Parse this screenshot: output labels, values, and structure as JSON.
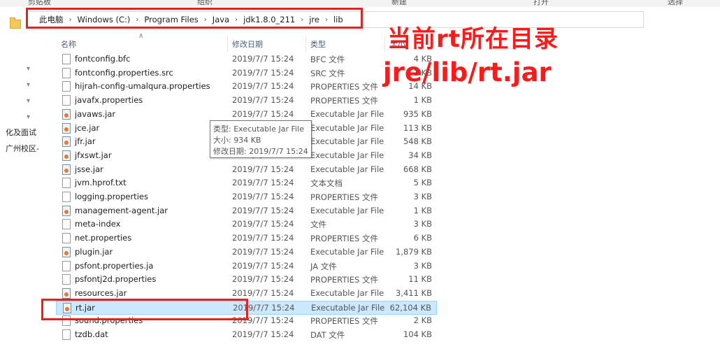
{
  "top_strip": [
    "剪贴板",
    "组织",
    "新建",
    "打开",
    "选择"
  ],
  "address_bar": {
    "crumbs": [
      "此电脑",
      "Windows (C:)",
      "Program Files",
      "Java",
      "jdk1.8.0_211",
      "jre",
      "lib"
    ]
  },
  "annotations": {
    "line1": "当前rt所在目录",
    "line2": "jre/lib/rt.jar"
  },
  "nav_pane": {
    "text1": "化及面试",
    "text2": "广州校区-"
  },
  "columns": {
    "name": "名称",
    "date": "修改日期",
    "type": "类型",
    "size": "大小"
  },
  "files": [
    {
      "name": "fontconfig.bfc",
      "date": "2019/7/7 15:24",
      "type": "BFC 文件",
      "size": "4 KB",
      "icon": "file-icon"
    },
    {
      "name": "fontconfig.properties.src",
      "date": "2019/7/7 15:24",
      "type": "SRC 文件",
      "size": "1 KB",
      "icon": "file-icon"
    },
    {
      "name": "hijrah-config-umalqura.properties",
      "date": "2019/7/7 15:24",
      "type": "PROPERTIES 文件",
      "size": "14 KB",
      "icon": "file-icon"
    },
    {
      "name": "javafx.properties",
      "date": "2019/7/7 15:24",
      "type": "PROPERTIES 文件",
      "size": "1 KB",
      "icon": "file-icon"
    },
    {
      "name": "javaws.jar",
      "date": "2019/7/7 15:24",
      "type": "Executable Jar File",
      "size": "935 KB",
      "icon": "jar-icon"
    },
    {
      "name": "jce.jar",
      "date": "2019/7/7 15:24",
      "type": "Executable Jar File",
      "size": "113 KB",
      "icon": "jar-icon"
    },
    {
      "name": "jfr.jar",
      "date": "2019/7/7 15:24",
      "type": "Executable Jar File",
      "size": "548 KB",
      "icon": "jar-icon"
    },
    {
      "name": "jfxswt.jar",
      "date": "2019/7/7 15:24",
      "type": "Executable Jar File",
      "size": "34 KB",
      "icon": "jar-icon"
    },
    {
      "name": "jsse.jar",
      "date": "2019/7/7 15:24",
      "type": "Executable Jar File",
      "size": "668 KB",
      "icon": "jar-icon"
    },
    {
      "name": "jvm.hprof.txt",
      "date": "2019/7/7 15:24",
      "type": "文本文档",
      "size": "5 KB",
      "icon": "file-icon"
    },
    {
      "name": "logging.properties",
      "date": "2019/7/7 15:24",
      "type": "PROPERTIES 文件",
      "size": "3 KB",
      "icon": "file-icon"
    },
    {
      "name": "management-agent.jar",
      "date": "2019/7/7 15:24",
      "type": "Executable Jar File",
      "size": "1 KB",
      "icon": "jar-icon"
    },
    {
      "name": "meta-index",
      "date": "2019/7/7 15:24",
      "type": "文件",
      "size": "3 KB",
      "icon": "file-icon"
    },
    {
      "name": "net.properties",
      "date": "2019/7/7 15:24",
      "type": "PROPERTIES 文件",
      "size": "6 KB",
      "icon": "file-icon"
    },
    {
      "name": "plugin.jar",
      "date": "2019/7/7 15:24",
      "type": "Executable Jar File",
      "size": "1,879 KB",
      "icon": "jar-icon"
    },
    {
      "name": "psfont.properties.ja",
      "date": "2019/7/7 15:24",
      "type": "JA 文件",
      "size": "3 KB",
      "icon": "file-icon"
    },
    {
      "name": "psfontj2d.properties",
      "date": "2019/7/7 15:24",
      "type": "PROPERTIES 文件",
      "size": "11 KB",
      "icon": "file-icon"
    },
    {
      "name": "resources.jar",
      "date": "2019/7/7 15:24",
      "type": "Executable Jar File",
      "size": "3,411 KB",
      "icon": "jar-icon"
    },
    {
      "name": "rt.jar",
      "date": "2019/7/7 15:24",
      "type": "Executable Jar File",
      "size": "62,104 KB",
      "icon": "jar-icon",
      "selected": true
    },
    {
      "name": "sound.properties",
      "date": "2019/7/7 15:24",
      "type": "PROPERTIES 文件",
      "size": "2 KB",
      "icon": "file-icon"
    },
    {
      "name": "tzdb.dat",
      "date": "2019/7/7 15:24",
      "type": "DAT 文件",
      "size": "104 KB",
      "icon": "file-icon"
    }
  ],
  "tooltip": {
    "type": "类型: Executable Jar File",
    "size": "大小: 934 KB",
    "modified": "修改日期: 2019/7/7 15:24"
  },
  "colors": {
    "accent_red": "#e32222",
    "selection": "#cce8ff",
    "annotation_red": "#ff1a1a"
  }
}
